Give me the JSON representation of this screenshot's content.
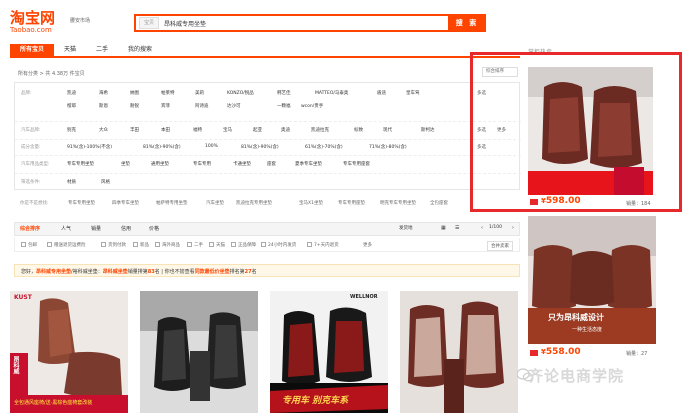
{
  "header": {
    "logo_cn": "淘宝网",
    "logo_en": "Taobao.com",
    "location": "腰安市场",
    "search_scope": "宝贝",
    "search_query": "昂科威专用坐垫",
    "search_button": "搜 索"
  },
  "tabs": [
    "所有宝贝",
    "天猫",
    "二手",
    "我的搜索"
  ],
  "summary": "所有分类 > 共 4.38万 件宝贝",
  "sort_select": "综合排序",
  "filters": {
    "brand_label": "品牌:",
    "brands_row1": [
      "凯迪",
      "海希",
      "纳图",
      "帕莱特",
      "美莉",
      "KONZO/锐品",
      "韩艺佳",
      "MATTEO/马泰奥",
      "盾途",
      "皇车驾"
    ],
    "brands_row2": [
      "橙耶",
      "斯恩",
      "耐锐",
      "宾菲",
      "阿诗迪",
      "达沙可",
      "一颗福",
      "wcon/贵手"
    ],
    "multi": "多选",
    "type_label": "汽车品牌:",
    "types": [
      "别克",
      "大众",
      "丰田",
      "本田",
      "福特",
      "宝马",
      "起亚",
      "奥迪",
      "凯迪拉克",
      "标致",
      "现代",
      "斯柯达"
    ],
    "multi2": "多选",
    "more": "更多",
    "material_label": "成分含量:",
    "materials": [
      "91%(含)-100%(不含)",
      "81%(含)-90%(含)",
      "100%",
      "81%(含)-90%(含)",
      "61%(含)-70%(含)",
      "71%(含)-80%(含)"
    ],
    "multi3": "多选",
    "ctx_label": "汽车用品类型:",
    "ctx": [
      "专车专用坐垫",
      "坐垫",
      "通用坐垫",
      "专车专用",
      "卡通坐垫",
      "座套",
      "夏季专车坐垫",
      "专车专用座套"
    ],
    "filter_label": "筛选条件:",
    "filter_opts": [
      "材质",
      "风格"
    ]
  },
  "hot_label": "你是不是想找:",
  "hot_terms": [
    "专车专用坐垫",
    "四季专车坐垫",
    "帕萨特专用坐垫",
    "汽车坐垫",
    "凯迪拉克专用坐垫",
    "宝马X1坐垫",
    "专车专用座垫",
    "明克专车专用坐垫",
    "全包座套"
  ],
  "sortbar": {
    "items": [
      "综合排序",
      "人气",
      "销量",
      "信用",
      "价格"
    ],
    "range": "发货地",
    "pager": "1/100"
  },
  "checks": [
    "包邮",
    "赠送退货运费险",
    "货到付款",
    "新品",
    "海外商品",
    "二手",
    "天猫",
    "正品保障",
    "24小时内发货",
    "7+天内退货",
    "更多"
  ],
  "merge": "合并卖家",
  "notice": {
    "prefix": "您好，",
    "hl1": "昂科威专用坐垫",
    "mid": "/裕科威坐垫：",
    "hl2": "昂科威坐垫",
    "a": "销量排第",
    "n1": "83",
    "b": "名 | 你也不妨查看",
    "hl3": "同款最低价坐垫",
    "c": "排名第",
    "n2": "27",
    "d": "名"
  },
  "products": [
    {
      "brand": "KUST",
      "caption1": "昂科威",
      "caption2": "专用",
      "banner": "全包通风座椅/送·黑棕色座椅套改装"
    },
    {
      "caption1": ""
    },
    {
      "brand": "WELLNOR",
      "banner": "专用车 别克车系"
    },
    {
      "caption1": ""
    }
  ],
  "side": {
    "title": "掌柜热卖",
    "ad1_price": "598.00",
    "ad1_sales": "销量：184",
    "ad2_caption": "只为昂科威设计",
    "ad2_sub": "一种生活态度",
    "ad2_price": "558.00",
    "ad2_sales": "销量：27",
    "currency": "¥"
  },
  "watermark": "齐论电商学院",
  "colors": {
    "accent": "#ff4400",
    "highlight_box": "#e8292b",
    "seat_brown": "#7a3b2e"
  }
}
